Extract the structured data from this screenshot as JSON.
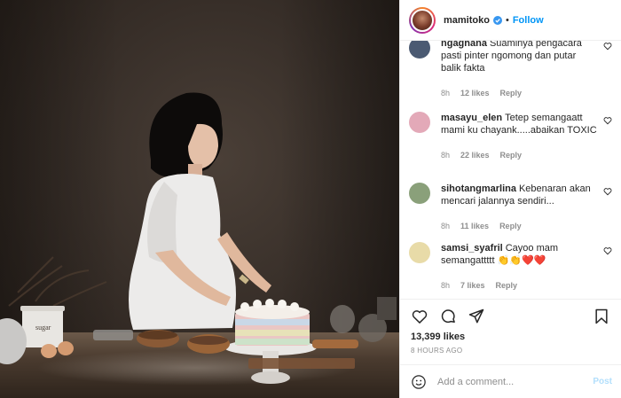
{
  "header": {
    "username": "mamitoko",
    "follow_label": "Follow",
    "dot": "•"
  },
  "comments": [
    {
      "username": "ngaghana",
      "text": "Suaminya pengacara pasti pinter ngomong dan putar balik fakta",
      "time": "8h",
      "likes": "12 likes",
      "reply": "Reply",
      "avatar_color": "#4b5a72"
    },
    {
      "username": "masayu_elen",
      "text": "Tetep semangaatt mami ku chayank.....abaikan TOXIC",
      "time": "8h",
      "likes": "22 likes",
      "reply": "Reply",
      "avatar_color": "#e3a9b8"
    },
    {
      "username": "sihotangmarlina",
      "text": "Kebenaran akan mencari jalannya sendiri...",
      "time": "8h",
      "likes": "11 likes",
      "reply": "Reply",
      "avatar_color": "#8aa07a"
    },
    {
      "username": "samsi_syafril",
      "text": "Cayoo mam semangattttt 👏👏❤️❤️",
      "time": "8h",
      "likes": "7 likes",
      "reply": "Reply",
      "avatar_color": "#e8dba8"
    }
  ],
  "actions": {
    "icons": [
      "heart-icon",
      "comment-icon",
      "share-icon",
      "bookmark-icon"
    ],
    "likes": "13,399 likes",
    "posted": "8 HOURS AGO"
  },
  "add_comment": {
    "placeholder": "Add a comment...",
    "post_label": "Post"
  },
  "photo": {
    "jar_label": "sugar"
  },
  "colors": {
    "accent": "#0095f6",
    "muted": "#8e8e8e",
    "post_disabled": "#b2dffc"
  }
}
